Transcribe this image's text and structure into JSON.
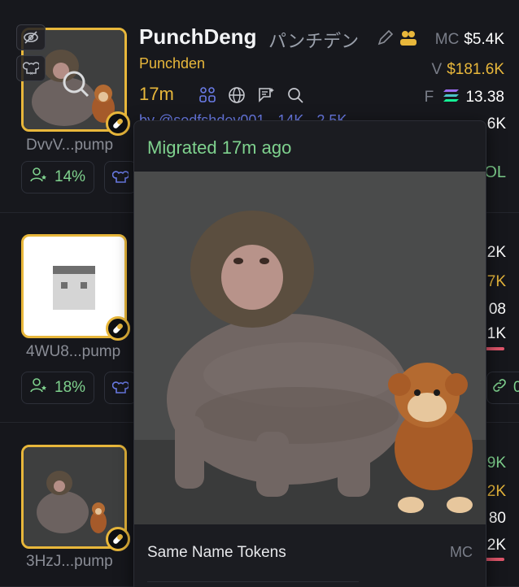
{
  "rows": [
    {
      "address": "DvvV...pump",
      "holders_pct": "14%",
      "name": "PunchDeng",
      "jp_name": "パンチデン",
      "subname": "Punchden",
      "age": "17m",
      "creator_cut": "by @sodfshdev001 · 14K · 2.5K",
      "stats": {
        "mc_label": "MC",
        "mc_value": "$5.4K",
        "v_label": "V",
        "v_value": "$181.6K",
        "f_label": "F",
        "f_value": "13.38",
        "tx_frag": "6K",
        "frag_col": "OL"
      }
    },
    {
      "address": "4WU8...pump",
      "holders_pct": "18%",
      "frags": [
        "2K",
        "7K",
        "08",
        "1K"
      ],
      "chip_frag": "0"
    },
    {
      "address": "3HzJ...pump",
      "frags": [
        "9K",
        "2K",
        "80",
        "2K"
      ]
    }
  ],
  "popup": {
    "header": "Migrated 17m ago",
    "same_name_title": "Same Name Tokens",
    "mc_label": "MC"
  },
  "icons": {
    "hide": "eye-off-icon",
    "chef": "chef-hat-icon",
    "search": "magnifier-icon",
    "pill": "pill-icon",
    "edit": "pencil-icon",
    "people": "people-icon",
    "holders": "holders-icon",
    "web": "globe-icon",
    "note": "note-icon",
    "lookup": "search-icon",
    "solana": "solana-icon"
  },
  "colors": {
    "accent_gold": "#e8b73b",
    "green": "#7fd28e",
    "red": "#e0566b",
    "muted": "#7a7e89"
  }
}
